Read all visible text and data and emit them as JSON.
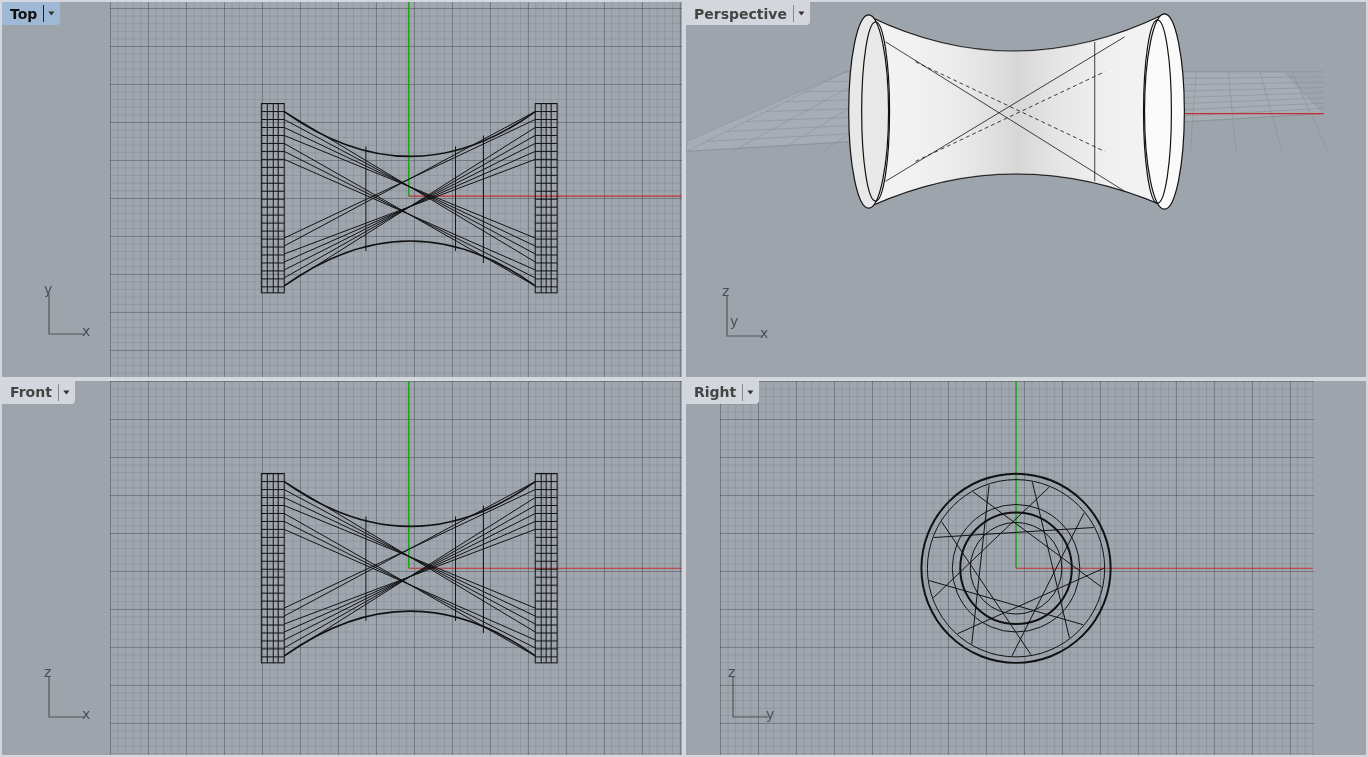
{
  "viewports": [
    {
      "title": "Top",
      "kind": "top",
      "selected": true,
      "axes": [
        "y",
        "x"
      ]
    },
    {
      "title": "Perspective",
      "kind": "perspective",
      "selected": false,
      "axes": [
        "z",
        "y",
        "x"
      ]
    },
    {
      "title": "Front",
      "kind": "front",
      "selected": false,
      "axes": [
        "z",
        "x"
      ]
    },
    {
      "title": "Right",
      "kind": "right",
      "selected": false,
      "axes": [
        "z",
        "y"
      ]
    }
  ]
}
